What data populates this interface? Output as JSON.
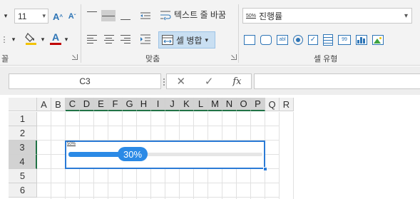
{
  "ribbon": {
    "font_size": "11",
    "wrap_text_label": "텍스트 줄 바꿈",
    "merge_label": "셀 병합",
    "style_combo_label": "진행률",
    "style_combo_icon_text": "50%",
    "group_font_partial": "꼴",
    "group_alignment": "맞춤",
    "group_cell_style": "셀 유형"
  },
  "formula_bar": {
    "name_box": "C3",
    "cancel_symbol": "✕",
    "enter_symbol": "✓",
    "fx_symbol": "fx"
  },
  "grid": {
    "columns": [
      "A",
      "B",
      "C",
      "D",
      "E",
      "F",
      "G",
      "H",
      "I",
      "J",
      "K",
      "L",
      "M",
      "N",
      "O",
      "P",
      "Q",
      "R"
    ],
    "selected_columns": [
      "C",
      "D",
      "E",
      "F",
      "G",
      "H",
      "I",
      "J",
      "K",
      "L",
      "M",
      "N",
      "O",
      "P"
    ],
    "rows": [
      "1",
      "2",
      "3",
      "4",
      "5",
      "6"
    ],
    "selected_rows": [
      "3",
      "4"
    ]
  },
  "progress_cell": {
    "value_percent": 30,
    "label": "30%",
    "icon_text": "50%"
  },
  "colors": {
    "accent": "#2b8ae6",
    "selection": "#2b7bd6",
    "header_selected_line": "#217346"
  }
}
